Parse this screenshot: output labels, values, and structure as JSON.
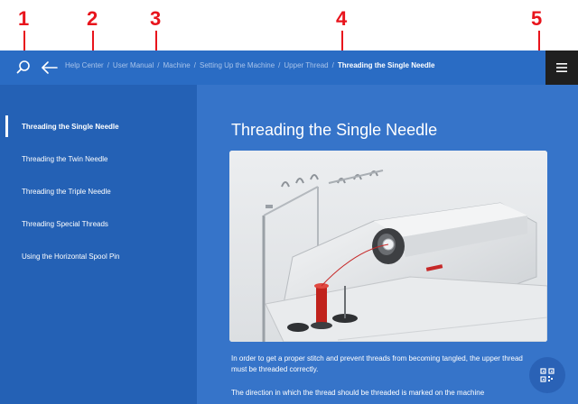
{
  "callouts": [
    "1",
    "2",
    "3",
    "4",
    "5"
  ],
  "breadcrumb": {
    "items": [
      "Help Center",
      "User Manual",
      "Machine",
      "Setting Up the Machine",
      "Upper Thread"
    ],
    "current": "Threading the Single Needle",
    "separator": "/"
  },
  "sidebar": {
    "items": [
      {
        "label": "Threading the Single Needle",
        "active": true
      },
      {
        "label": "Threading the Twin Needle"
      },
      {
        "label": "Threading the Triple Needle"
      },
      {
        "label": "Threading Special Threads"
      },
      {
        "label": "Using the Horizontal Spool Pin"
      }
    ]
  },
  "main": {
    "title": "Threading the Single Needle",
    "paragraph1": "In order to get a proper stitch and prevent threads from becoming tangled, the upper thread must be threaded correctly.",
    "paragraph2": "The direction in which the thread should be threaded is marked on the machine"
  },
  "colors": {
    "topbar": "#2a6cc4",
    "sidebar": "#2461b5",
    "main": "#3674c9",
    "callout": "#e8141c"
  },
  "icons": {
    "search": "search-icon",
    "back": "arrow-left-icon",
    "menu": "hamburger-menu-icon",
    "fab": "qr-code-icon"
  }
}
